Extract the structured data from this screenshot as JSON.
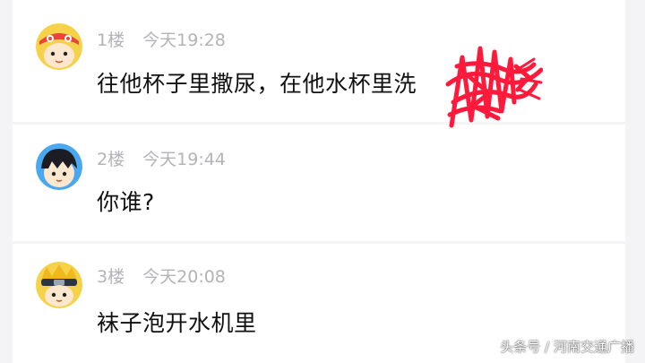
{
  "comments": [
    {
      "floor": "1楼",
      "time": "今天19:28",
      "text": "往他杯子里撒尿，在他水杯里洗",
      "avatar_icon": "cartoon-boy-red-bandana-icon"
    },
    {
      "floor": "2楼",
      "time": "今天19:44",
      "text": "你谁?",
      "avatar_icon": "cartoon-boy-black-hair-icon"
    },
    {
      "floor": "3楼",
      "time": "今天20:08",
      "text": "袜子泡开水机里",
      "avatar_icon": "cartoon-ninja-headband-icon"
    }
  ],
  "watermark": "头条号 / 河南交通广播",
  "colors": {
    "background": "#f4f4f6",
    "card": "#ffffff",
    "meta_text": "#b3b3b8",
    "content_text": "#111111",
    "redaction": "#ff1a3c"
  }
}
